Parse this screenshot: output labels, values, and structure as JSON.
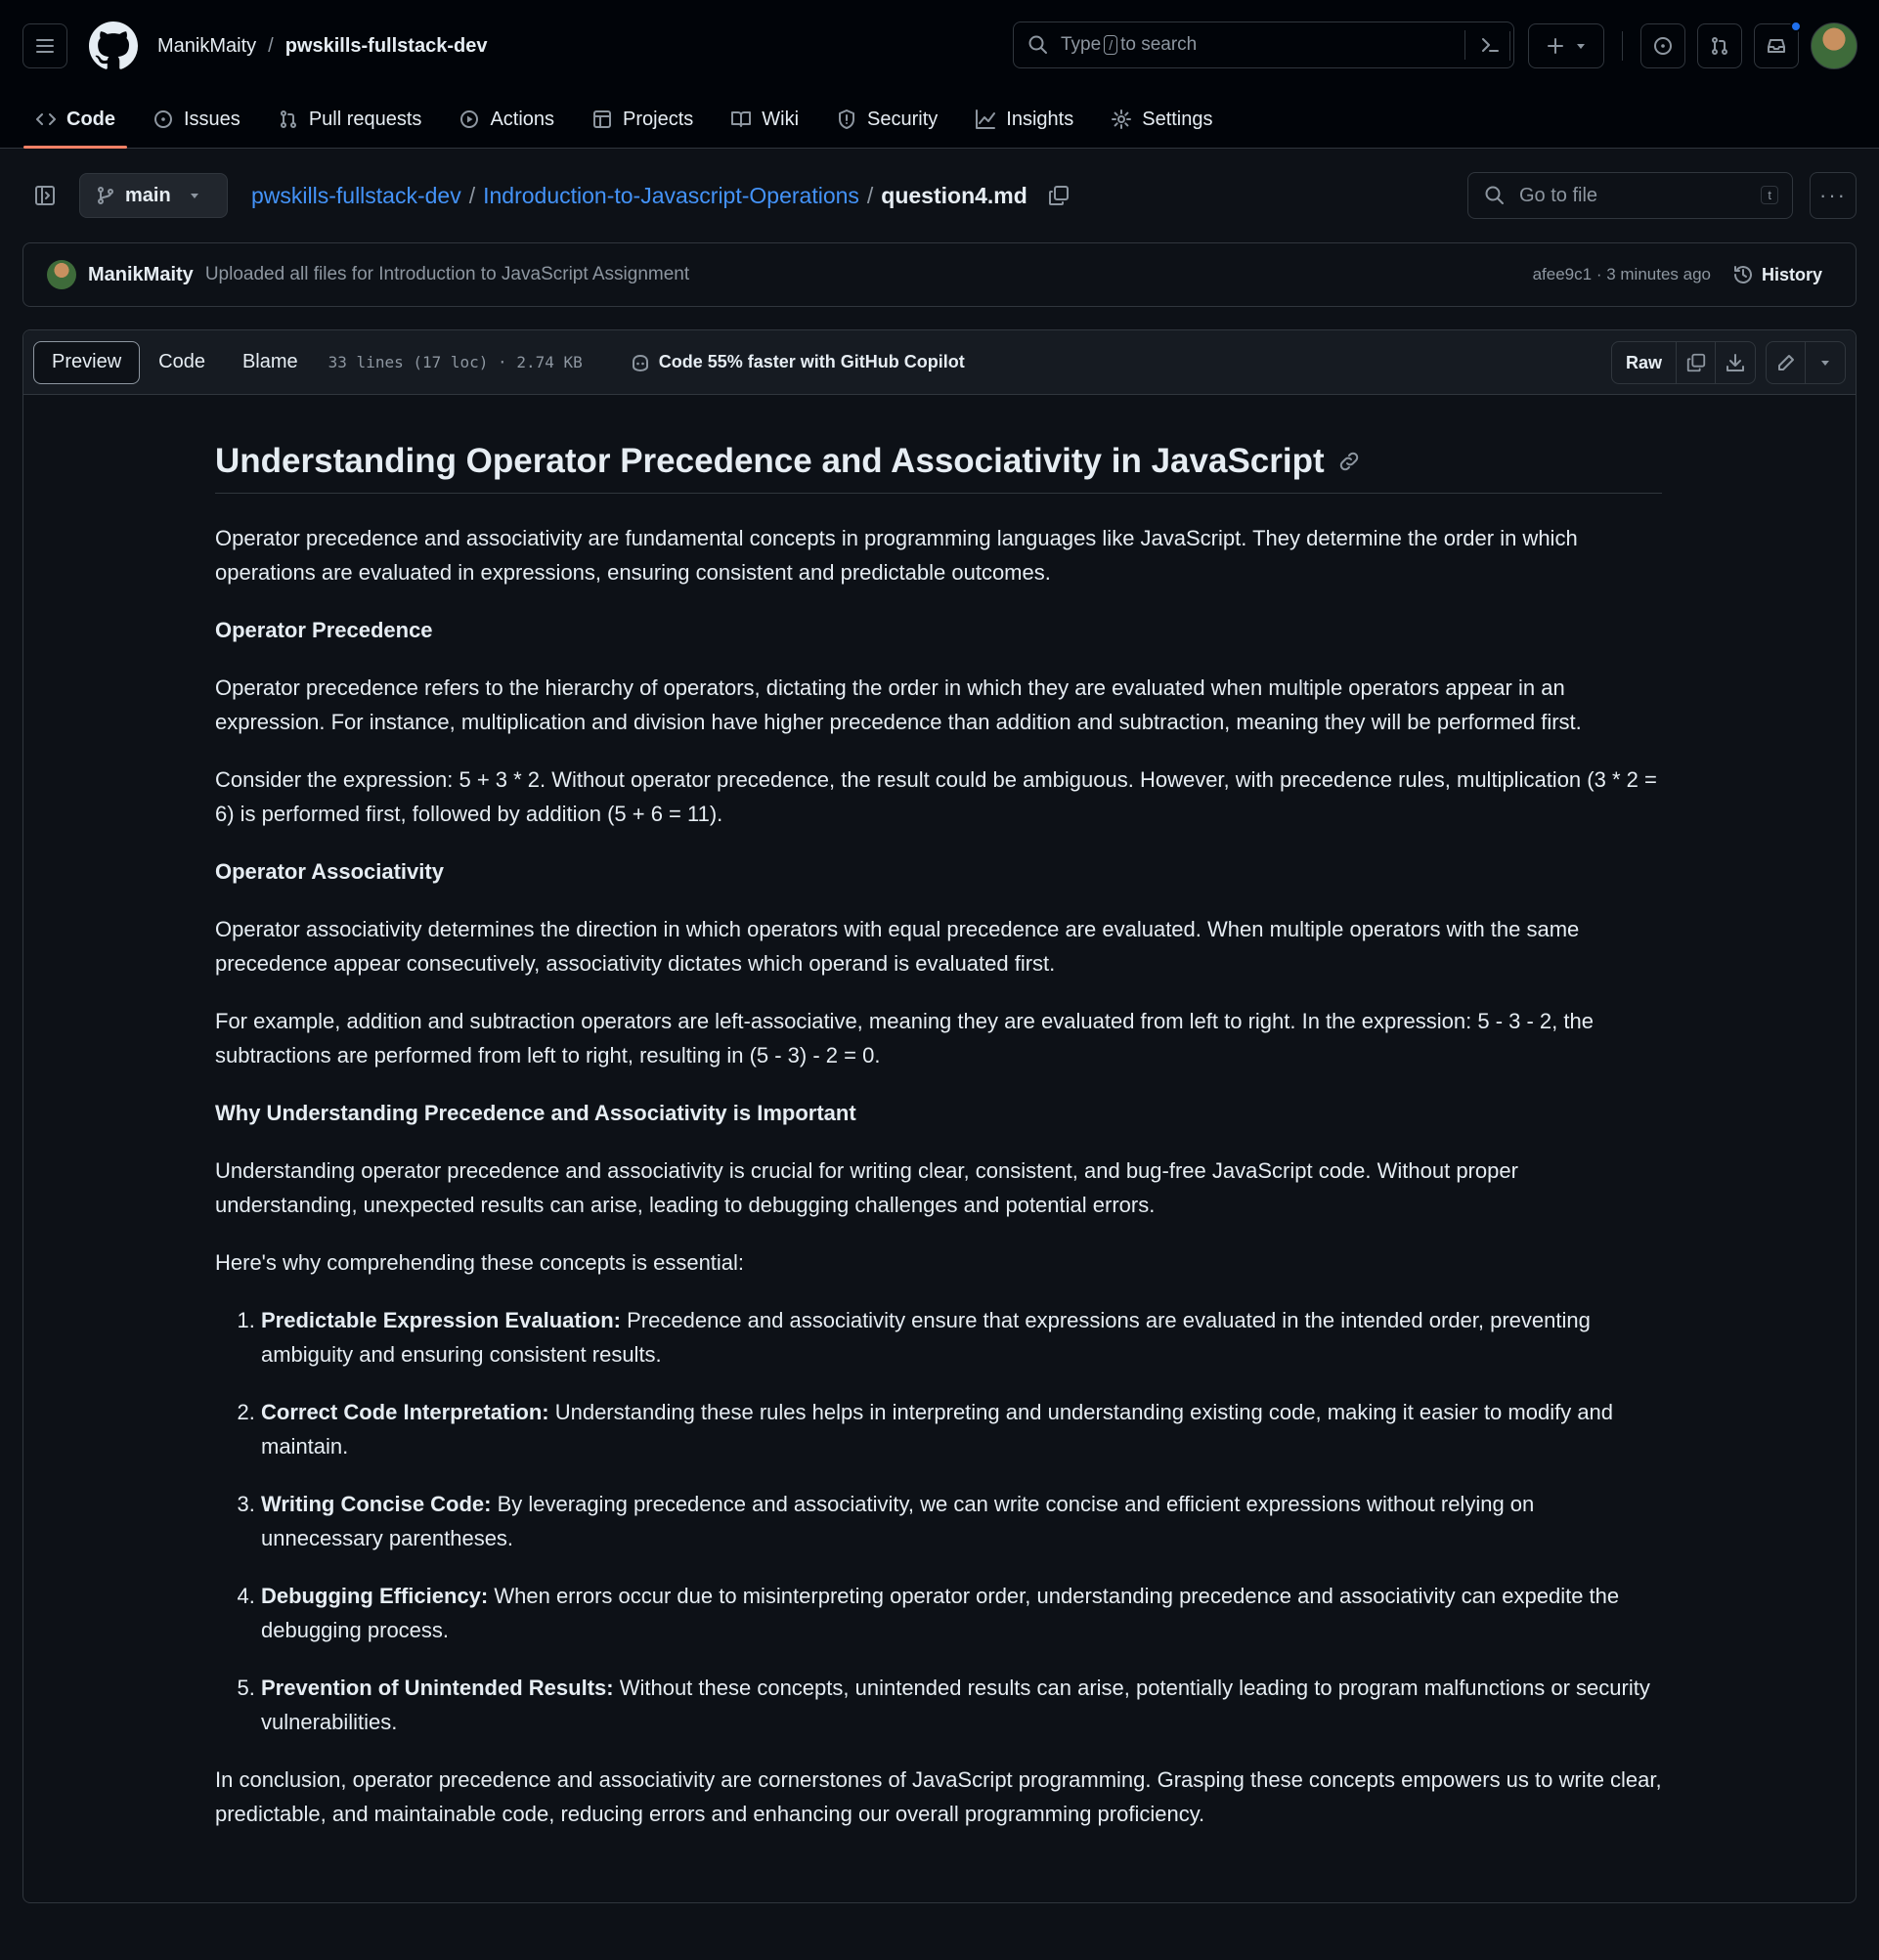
{
  "header": {
    "owner": "ManikMaity",
    "separator": "/",
    "repo": "pwskills-fullstack-dev",
    "search": {
      "prefix": "Type",
      "key": "/",
      "suffix": "to search"
    },
    "colors": {
      "notification_dot": "#1f6feb",
      "active_tab_underline": "#f78166"
    },
    "tabs": [
      {
        "label": "Code",
        "icon": "code-icon",
        "active": true
      },
      {
        "label": "Issues",
        "icon": "issue-icon"
      },
      {
        "label": "Pull requests",
        "icon": "pull-request-icon"
      },
      {
        "label": "Actions",
        "icon": "play-icon"
      },
      {
        "label": "Projects",
        "icon": "table-icon"
      },
      {
        "label": "Wiki",
        "icon": "book-icon"
      },
      {
        "label": "Security",
        "icon": "shield-icon"
      },
      {
        "label": "Insights",
        "icon": "graph-icon"
      },
      {
        "label": "Settings",
        "icon": "gear-icon"
      }
    ]
  },
  "filenav": {
    "branch": "main",
    "path": {
      "repo": "pwskills-fullstack-dev",
      "folder": "Indroduction-to-Javascript-Operations",
      "file": "question4.md",
      "sep": "/"
    },
    "go_to_file": {
      "placeholder": "Go to file",
      "key": "t"
    },
    "more": "···"
  },
  "commit": {
    "author": "ManikMaity",
    "message": "Uploaded all files for Introduction to JavaScript Assignment",
    "meta": "afee9c1 · 3 minutes ago",
    "history": "History"
  },
  "file": {
    "views": [
      "Preview",
      "Code",
      "Blame"
    ],
    "active_view": "Preview",
    "meta": "33 lines (17 loc) · 2.74 KB",
    "copilot": "Code 55% faster with GitHub Copilot",
    "raw": "Raw"
  },
  "content": {
    "title": "Understanding Operator Precedence and Associativity in JavaScript",
    "intro": "Operator precedence and associativity are fundamental concepts in programming languages like JavaScript. They determine the order in which operations are evaluated in expressions, ensuring consistent and predictable outcomes.",
    "h_precedence": "Operator Precedence",
    "p_precedence_1": "Operator precedence refers to the hierarchy of operators, dictating the order in which they are evaluated when multiple operators appear in an expression. For instance, multiplication and division have higher precedence than addition and subtraction, meaning they will be performed first.",
    "p_precedence_2": "Consider the expression: 5 + 3 * 2. Without operator precedence, the result could be ambiguous. However, with precedence rules, multiplication (3 * 2 = 6) is performed first, followed by addition (5 + 6 = 11).",
    "h_associativity": "Operator Associativity",
    "p_assoc_1": "Operator associativity determines the direction in which operators with equal precedence are evaluated. When multiple operators with the same precedence appear consecutively, associativity dictates which operand is evaluated first.",
    "p_assoc_2": "For example, addition and subtraction operators are left-associative, meaning they are evaluated from left to right. In the expression: 5 - 3 - 2, the subtractions are performed from left to right, resulting in (5 - 3) - 2 = 0.",
    "h_why": "Why Understanding Precedence and Associativity is Important",
    "p_why_1": "Understanding operator precedence and associativity is crucial for writing clear, consistent, and bug-free JavaScript code. Without proper understanding, unexpected results can arise, leading to debugging challenges and potential errors.",
    "p_why_2": "Here's why comprehending these concepts is essential:",
    "list": [
      {
        "term": "Predictable Expression Evaluation:",
        "text": " Precedence and associativity ensure that expressions are evaluated in the intended order, preventing ambiguity and ensuring consistent results."
      },
      {
        "term": "Correct Code Interpretation:",
        "text": " Understanding these rules helps in interpreting and understanding existing code, making it easier to modify and maintain."
      },
      {
        "term": "Writing Concise Code:",
        "text": " By leveraging precedence and associativity, we can write concise and efficient expressions without relying on unnecessary parentheses."
      },
      {
        "term": "Debugging Efficiency:",
        "text": " When errors occur due to misinterpreting operator order, understanding precedence and associativity can expedite the debugging process."
      },
      {
        "term": "Prevention of Unintended Results:",
        "text": " Without these concepts, unintended results can arise, potentially leading to program malfunctions or security vulnerabilities."
      }
    ],
    "conclusion": "In conclusion, operator precedence and associativity are cornerstones of JavaScript programming. Grasping these concepts empowers us to write clear, predictable, and maintainable code, reducing errors and enhancing our overall programming proficiency."
  }
}
